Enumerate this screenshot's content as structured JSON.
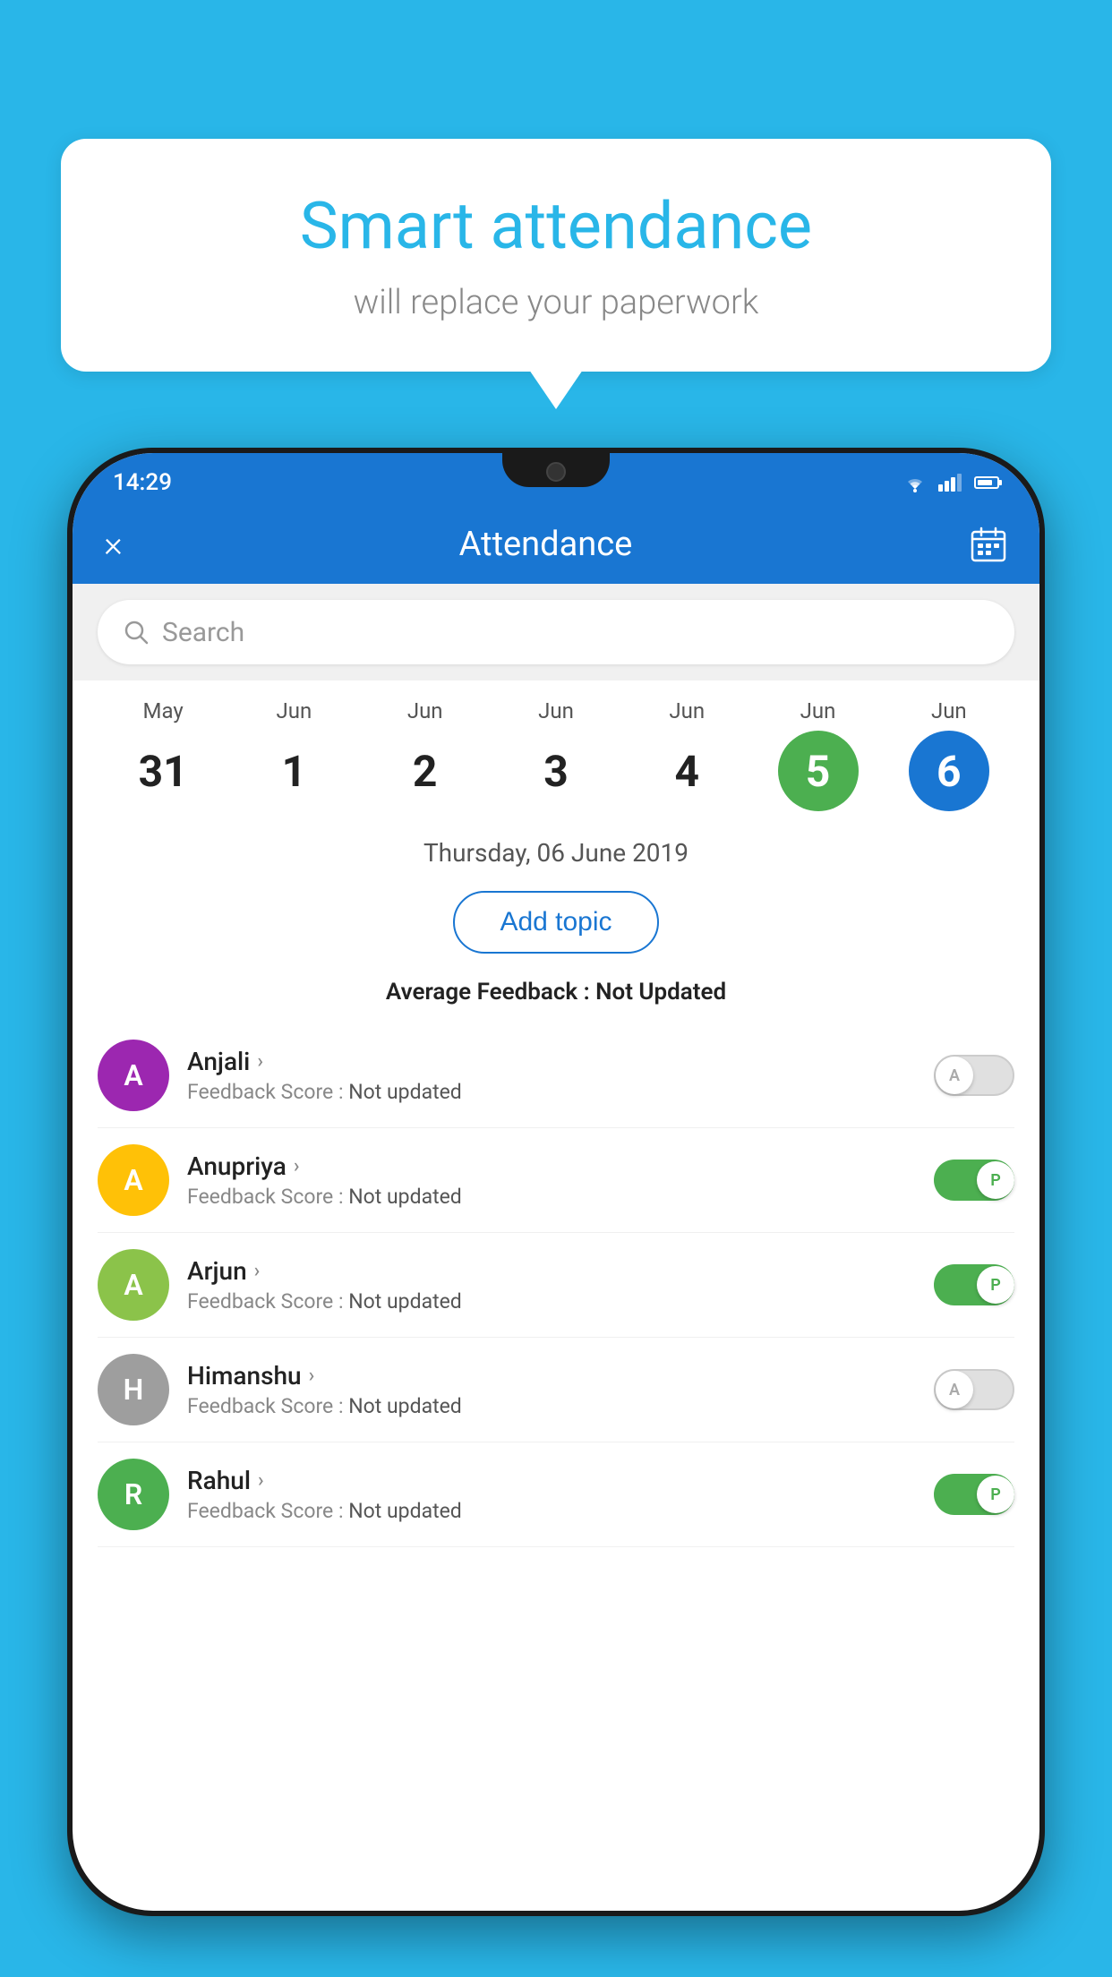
{
  "background_color": "#29b6e8",
  "bubble": {
    "title": "Smart attendance",
    "subtitle": "will replace your paperwork"
  },
  "status_bar": {
    "time": "14:29",
    "wifi": "▼",
    "signal": "▲",
    "battery": "battery"
  },
  "app_bar": {
    "title": "Attendance",
    "close_label": "×",
    "calendar_label": "📅"
  },
  "search": {
    "placeholder": "Search"
  },
  "calendar": {
    "days": [
      {
        "month": "May",
        "date": "31",
        "state": "normal"
      },
      {
        "month": "Jun",
        "date": "1",
        "state": "normal"
      },
      {
        "month": "Jun",
        "date": "2",
        "state": "normal"
      },
      {
        "month": "Jun",
        "date": "3",
        "state": "normal"
      },
      {
        "month": "Jun",
        "date": "4",
        "state": "normal"
      },
      {
        "month": "Jun",
        "date": "5",
        "state": "today"
      },
      {
        "month": "Jun",
        "date": "6",
        "state": "selected"
      }
    ]
  },
  "selected_date": "Thursday, 06 June 2019",
  "add_topic_label": "Add topic",
  "avg_feedback_label": "Average Feedback :",
  "avg_feedback_value": "Not Updated",
  "students": [
    {
      "name": "Anjali",
      "avatar_letter": "A",
      "avatar_color": "#9c27b0",
      "feedback_label": "Feedback Score :",
      "feedback_value": "Not updated",
      "toggle": "off",
      "toggle_letter": "A"
    },
    {
      "name": "Anupriya",
      "avatar_letter": "A",
      "avatar_color": "#ffc107",
      "feedback_label": "Feedback Score :",
      "feedback_value": "Not updated",
      "toggle": "on",
      "toggle_letter": "P"
    },
    {
      "name": "Arjun",
      "avatar_letter": "A",
      "avatar_color": "#8bc34a",
      "feedback_label": "Feedback Score :",
      "feedback_value": "Not updated",
      "toggle": "on",
      "toggle_letter": "P"
    },
    {
      "name": "Himanshu",
      "avatar_letter": "H",
      "avatar_color": "#9e9e9e",
      "feedback_label": "Feedback Score :",
      "feedback_value": "Not updated",
      "toggle": "off",
      "toggle_letter": "A"
    },
    {
      "name": "Rahul",
      "avatar_letter": "R",
      "avatar_color": "#4caf50",
      "feedback_label": "Feedback Score :",
      "feedback_value": "Not updated",
      "toggle": "on",
      "toggle_letter": "P"
    }
  ]
}
